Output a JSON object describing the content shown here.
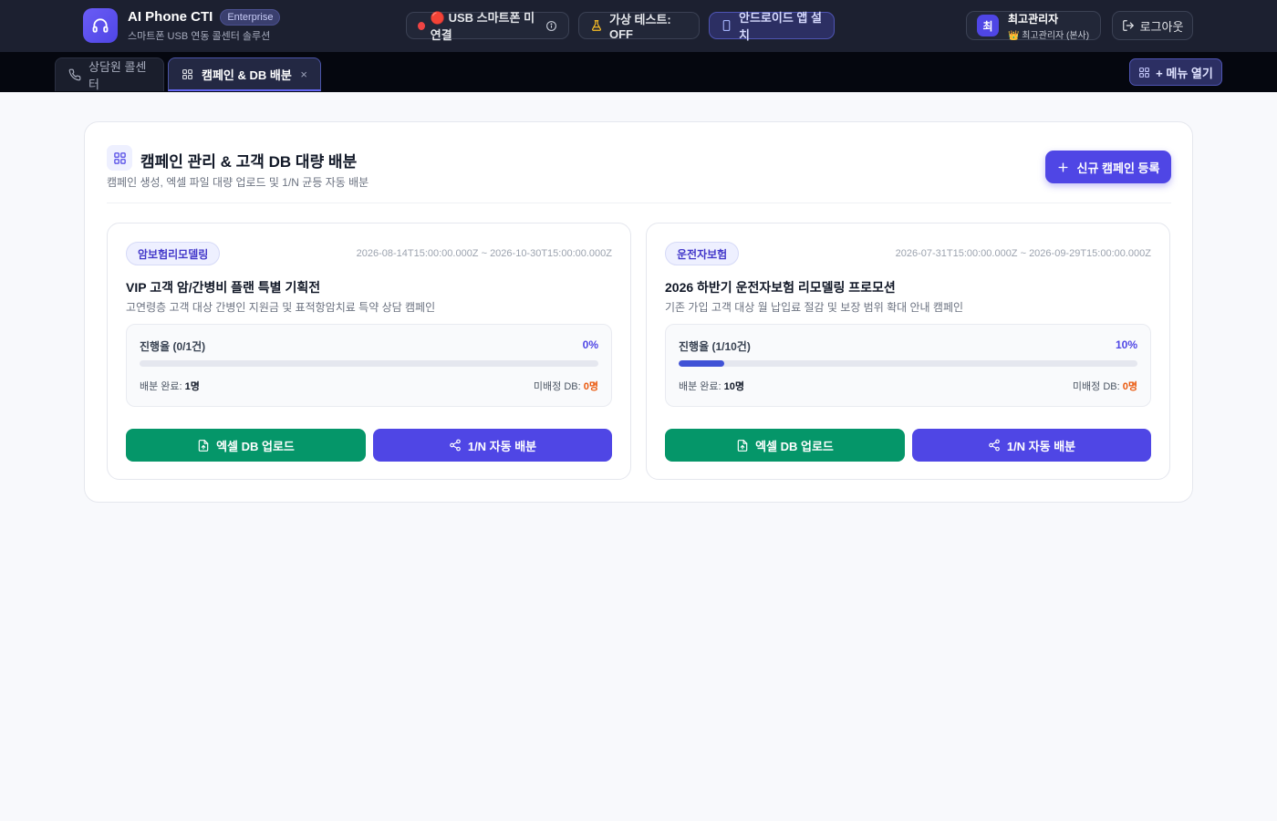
{
  "header": {
    "app_title": "AI Phone CTI",
    "edition_badge": "Enterprise",
    "subtitle": "스마트폰 USB 연동 콜센터 솔루션",
    "usb_status": "🔴 USB 스마트폰 미연결",
    "virtual_test": "가상 테스트: OFF",
    "android_install": "안드로이드 앱 설치",
    "user": {
      "avatar_initial": "최",
      "name": "최고관리자",
      "role_icon": "👑",
      "role": "최고관리자 (본사)"
    },
    "logout": "로그아웃"
  },
  "tabs": [
    {
      "label": "상담원 콜센터",
      "active": false,
      "icon": "phone-icon"
    },
    {
      "label": "캠페인 & DB 배분",
      "active": true,
      "icon": "grid-icon",
      "close": "×"
    }
  ],
  "menu_button": "+ 메뉴 열기",
  "panel": {
    "title": "캠페인 관리 & 고객 DB 대량 배분",
    "subtitle": "캠페인 생성, 엑셀 파일 대량 업로드 및 1/N 균등 자동 배분",
    "new_button": "신규 캠페인 등록"
  },
  "campaigns": [
    {
      "tag": "암보험리모델링",
      "date_range": "2026-08-14T15:00:00.000Z ~ 2026-10-30T15:00:00.000Z",
      "title": "VIP 고객 암/간병비 플랜 특별 기획전",
      "description": "고연령층 고객 대상 간병인 지원금 및 표적항암치료 특약 상담 캠페인",
      "progress_label": "진행율 (0/1건)",
      "progress_pct_text": "0%",
      "progress_fraction": 0,
      "done_label": "배분 완료:",
      "done_value": "1명",
      "unassigned_label": "미배정 DB:",
      "unassigned_value": "0명",
      "upload_button": "엑셀 DB 업로드",
      "distribute_button": "1/N 자동 배분"
    },
    {
      "tag": "운전자보험",
      "date_range": "2026-07-31T15:00:00.000Z ~ 2026-09-29T15:00:00.000Z",
      "title": "2026 하반기 운전자보험 리모델링 프로모션",
      "description": "기존 가입 고객 대상 월 납입료 절감 및 보장 범위 확대 안내 캠페인",
      "progress_label": "진행율 (1/10건)",
      "progress_pct_text": "10%",
      "progress_fraction": 0.1,
      "done_label": "배분 완료:",
      "done_value": "10명",
      "unassigned_label": "미배정 DB:",
      "unassigned_value": "0명",
      "upload_button": "엑셀 DB 업로드",
      "distribute_button": "1/N 자동 배분"
    }
  ],
  "colors": {
    "topbar": "#1c2030",
    "tabbar": "#05070f",
    "accent": "#4f46e5",
    "upload_green": "#059669",
    "warning_orange": "#ea580c"
  }
}
